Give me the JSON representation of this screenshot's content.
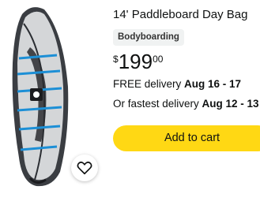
{
  "product": {
    "title": "14' Paddleboard Day Bag",
    "badge": "Bodyboarding",
    "price": {
      "currency": "$",
      "whole": "199",
      "fraction": "00"
    },
    "delivery": {
      "free_prefix": "FREE delivery ",
      "free_dates": "Aug 16 - 17",
      "fast_prefix": "Or fastest delivery ",
      "fast_dates": "Aug 12 - 13"
    },
    "add_to_cart_label": "Add to cart"
  },
  "colors": {
    "cart_button": "#ffd814",
    "badge_bg": "#f0f2f2",
    "text": "#0f1111"
  },
  "icons": {
    "wishlist": "heart-outline-icon"
  }
}
